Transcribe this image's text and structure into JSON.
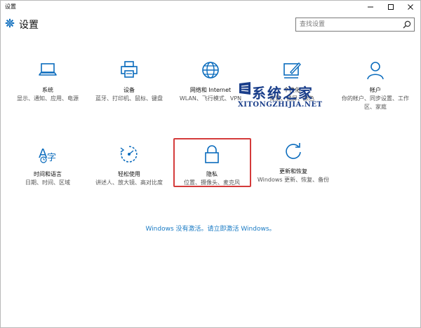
{
  "window": {
    "title": "设置"
  },
  "header": {
    "title": "设置"
  },
  "search": {
    "placeholder": "查找设置"
  },
  "tiles": [
    {
      "name": "系统",
      "desc": "显示、通知、应用、电源",
      "icon": "laptop-icon"
    },
    {
      "name": "设备",
      "desc": "蓝牙、打印机、鼠标、键盘",
      "icon": "printer-icon"
    },
    {
      "name": "网络和 Internet",
      "desc": "WLAN、飞行模式、VPN",
      "icon": "globe-icon"
    },
    {
      "name": "个性化",
      "desc": "背景、锁屏、颜色",
      "icon": "paint-icon"
    },
    {
      "name": "帐户",
      "desc": "你的帐户、同步设置、工作区、家庭",
      "icon": "person-icon"
    },
    {
      "name": "时间和语言",
      "desc": "日期、时间、区域",
      "icon": "time-language-icon"
    },
    {
      "name": "轻松使用",
      "desc": "讲述人、放大镜、高对比度",
      "icon": "ease-of-access-icon"
    },
    {
      "name": "隐私",
      "desc": "位置、摄像头、麦克风",
      "icon": "lock-icon"
    },
    {
      "name": "更新和恢复",
      "desc": "Windows 更新、恢复、备份",
      "icon": "refresh-icon"
    }
  ],
  "activation": {
    "text": "Windows 没有激活。请立即激活 Windows。"
  },
  "watermark": {
    "title": "系统之家",
    "subtitle": "XITONGZHIJIA.NET"
  },
  "colors": {
    "accent": "#1a7bc4",
    "icon_blue": "#0b6cbd",
    "highlight": "#d43b3b"
  }
}
